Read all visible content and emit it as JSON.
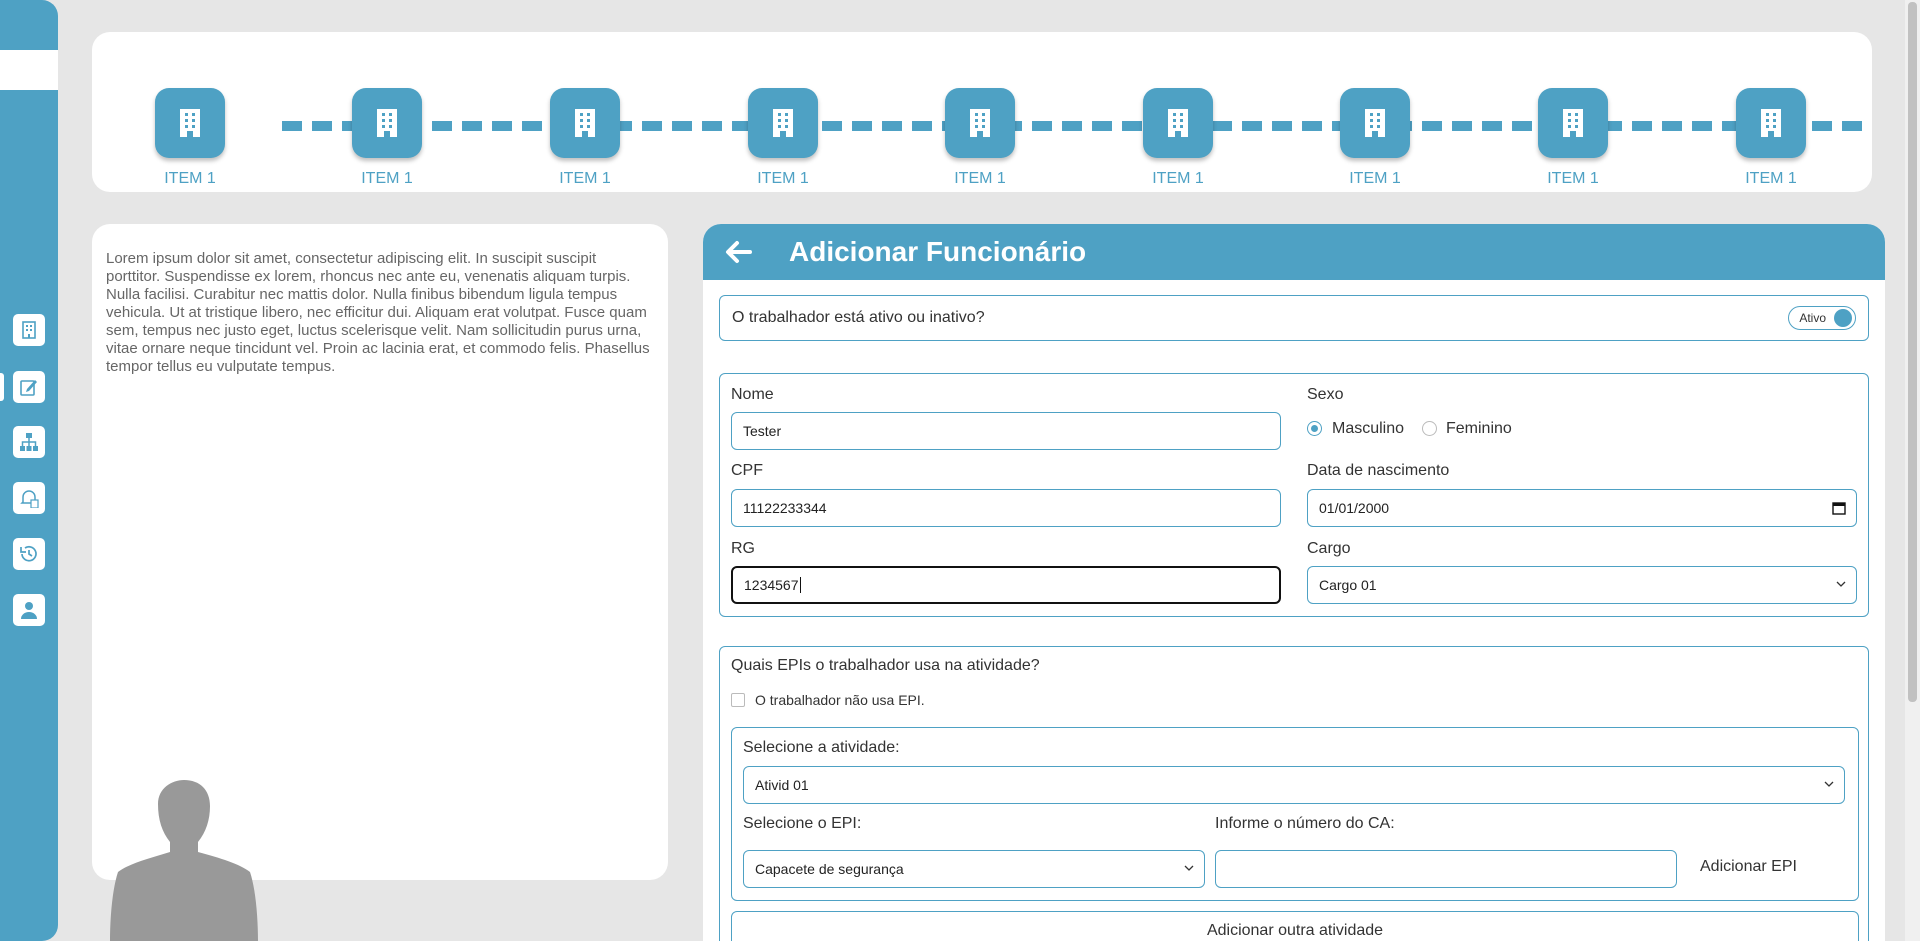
{
  "stepper": {
    "items": [
      {
        "label": "ITEM 1",
        "icon": "building-icon"
      },
      {
        "label": "ITEM 1",
        "icon": "building-icon"
      },
      {
        "label": "ITEM 1",
        "icon": "building-icon"
      },
      {
        "label": "ITEM 1",
        "icon": "building-icon"
      },
      {
        "label": "ITEM 1",
        "icon": "building-icon"
      },
      {
        "label": "ITEM 1",
        "icon": "building-icon"
      },
      {
        "label": "ITEM 1",
        "icon": "building-icon"
      },
      {
        "label": "ITEM 1",
        "icon": "building-icon"
      },
      {
        "label": "ITEM 1",
        "icon": "building-icon"
      }
    ]
  },
  "sidebar": {
    "items": [
      "building-icon",
      "edit-icon",
      "org-chart-icon",
      "bell-document-icon",
      "history-icon",
      "user-icon"
    ],
    "active": "edit-icon"
  },
  "info": {
    "text": "Lorem ipsum dolor sit amet, consectetur adipiscing elit. In suscipit suscipit porttitor. Suspendisse ex lorem, rhoncus nec ante eu, venenatis aliquam turpis. Nulla facilisi. Curabitur nec mattis dolor. Nulla finibus bibendum ligula tempus vehicula. Ut at tristique libero, nec efficitur dui. Aliquam erat volutpat. Fusce quam sem, tempus nec justo eget, luctus scelerisque velit. Nam sollicitudin purus urna, vitae ornare neque tincidunt vel. Proin ac lacinia erat, et commodo felis. Phasellus tempor tellus eu vulputate tempus."
  },
  "form": {
    "title": "Adicionar Funcionário",
    "status_question": "O trabalhador está ativo ou inativo?",
    "status_toggle": "Ativo",
    "name_label": "Nome",
    "name_value": "Tester",
    "sex_label": "Sexo",
    "sex_options": [
      "Masculino",
      "Feminino"
    ],
    "sex_selected": "Masculino",
    "cpf_label": "CPF",
    "cpf_value": "11122233344",
    "birth_label": "Data de nascimento",
    "birth_value": "01/01/2000",
    "rg_label": "RG",
    "rg_value": "1234567",
    "cargo_label": "Cargo",
    "cargo_value": "Cargo 01",
    "epi_question": "Quais EPIs o trabalhador usa na atividade?",
    "no_epi_label": "O trabalhador não usa EPI.",
    "activity_label": "Selecione a atividade:",
    "activity_value": "Ativid 01",
    "epi_label": "Selecione o EPI:",
    "epi_value": "Capacete de segurança",
    "ca_label": "Informe o número do CA:",
    "ca_value": "",
    "add_epi_button": "Adicionar EPI",
    "add_activity_button": "Adicionar outra atividade"
  },
  "colors": {
    "accent": "#4ea1c4",
    "background": "#e6e6e6"
  }
}
